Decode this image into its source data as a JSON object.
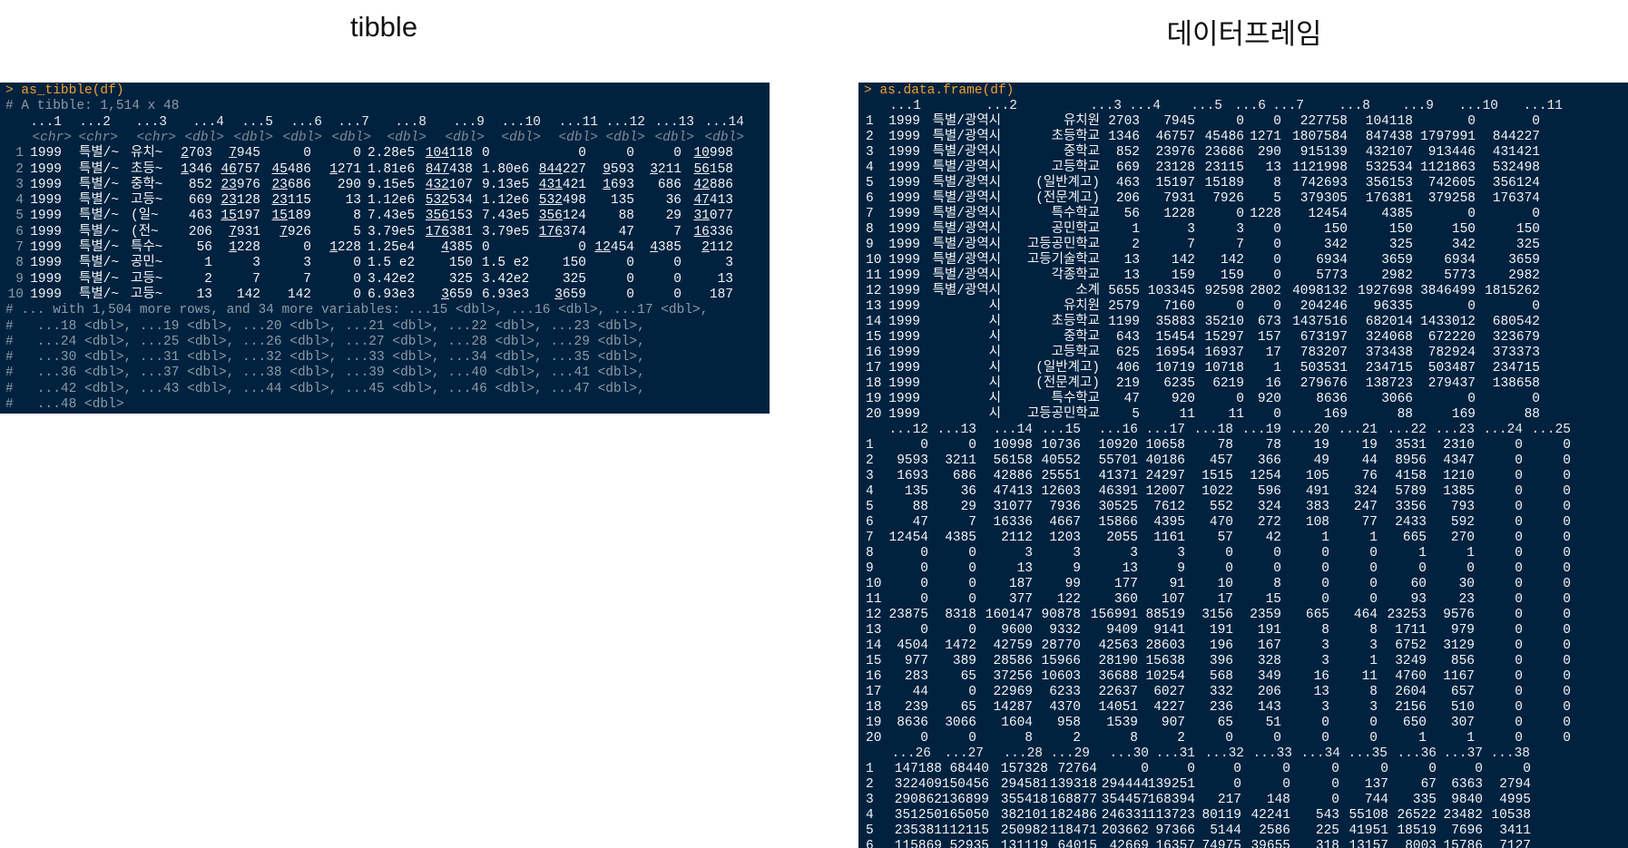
{
  "tibble": {
    "title": "tibble",
    "command": "> as_tibble(df)",
    "summary": "# A tibble: 1,514 x 48",
    "headers": [
      "...1",
      "...2",
      "...3",
      "...4",
      "...5",
      "...6",
      "...7",
      "...8",
      "...9",
      "...10",
      "...11",
      "...12",
      "...13",
      "...14"
    ],
    "types": [
      "<chr>",
      "<chr>",
      "<chr>",
      "<dbl>",
      "<dbl>",
      "<dbl>",
      "<dbl>",
      "<dbl>",
      "<dbl>",
      "<dbl>",
      "<dbl>",
      "<dbl>",
      "<dbl>",
      "<dbl>"
    ],
    "rows": [
      [
        "1",
        "1999",
        "특별/~",
        "유치~",
        "2703",
        "7945",
        "0",
        "0",
        "2.28e5",
        "104118",
        "0",
        "0",
        "0",
        "0",
        "10998"
      ],
      [
        "2",
        "1999",
        "특별/~",
        "초등~",
        "1346",
        "46757",
        "45486",
        "1271",
        "1.81e6",
        "847438",
        "1.80e6",
        "844227",
        "9593",
        "3211",
        "56158"
      ],
      [
        "3",
        "1999",
        "특별/~",
        "중학~",
        "852",
        "23976",
        "23686",
        "290",
        "9.15e5",
        "432107",
        "9.13e5",
        "431421",
        "1693",
        "686",
        "42886"
      ],
      [
        "4",
        "1999",
        "특별/~",
        "고등~",
        "669",
        "23128",
        "23115",
        "13",
        "1.12e6",
        "532534",
        "1.12e6",
        "532498",
        "135",
        "36",
        "47413"
      ],
      [
        "5",
        "1999",
        "특별/~",
        "(일~",
        "463",
        "15197",
        "15189",
        "8",
        "7.43e5",
        "356153",
        "7.43e5",
        "356124",
        "88",
        "29",
        "31077"
      ],
      [
        "6",
        "1999",
        "특별/~",
        "(전~",
        "206",
        "7931",
        "7926",
        "5",
        "3.79e5",
        "176381",
        "3.79e5",
        "176374",
        "47",
        "7",
        "16336"
      ],
      [
        "7",
        "1999",
        "특별/~",
        "특수~",
        "56",
        "1228",
        "0",
        "1228",
        "1.25e4",
        "4385",
        "0",
        "0",
        "12454",
        "4385",
        "2112"
      ],
      [
        "8",
        "1999",
        "특별/~",
        "공민~",
        "1",
        "3",
        "3",
        "0",
        "1.5 e2",
        "150",
        "1.5 e2",
        "150",
        "0",
        "0",
        "3"
      ],
      [
        "9",
        "1999",
        "특별/~",
        "고등~",
        "2",
        "7",
        "7",
        "0",
        "3.42e2",
        "325",
        "3.42e2",
        "325",
        "0",
        "0",
        "13"
      ],
      [
        "10",
        "1999",
        "특별/~",
        "고등~",
        "13",
        "142",
        "142",
        "0",
        "6.93e3",
        "3659",
        "6.93e3",
        "3659",
        "0",
        "0",
        "187"
      ]
    ],
    "footer": [
      "# ... with 1,504 more rows, and 34 more variables: ...15 <dbl>, ...16 <dbl>, ...17 <dbl>,",
      "#   ...18 <dbl>, ...19 <dbl>, ...20 <dbl>, ...21 <dbl>, ...22 <dbl>, ...23 <dbl>,",
      "#   ...24 <dbl>, ...25 <dbl>, ...26 <dbl>, ...27 <dbl>, ...28 <dbl>, ...29 <dbl>,",
      "#   ...30 <dbl>, ...31 <dbl>, ...32 <dbl>, ...33 <dbl>, ...34 <dbl>, ...35 <dbl>,",
      "#   ...36 <dbl>, ...37 <dbl>, ...38 <dbl>, ...39 <dbl>, ...40 <dbl>, ...41 <dbl>,",
      "#   ...42 <dbl>, ...43 <dbl>, ...44 <dbl>, ...45 <dbl>, ...46 <dbl>, ...47 <dbl>,",
      "#   ...48 <dbl>"
    ]
  },
  "data_frame": {
    "title": "데이터프레임",
    "command": "> as.data.frame(df)",
    "blocks": [
      {
        "headers": [
          "...1",
          "...2",
          "...3",
          "...4",
          "...5",
          "...6",
          "...7",
          "...8",
          "...9",
          "...10",
          "...11"
        ],
        "rows": [
          [
            "1",
            "1999",
            "특별/광역시",
            "유치원",
            "2703",
            "7945",
            "0",
            "0",
            "227758",
            "104118",
            "0",
            "0"
          ],
          [
            "2",
            "1999",
            "특별/광역시",
            "초등학교",
            "1346",
            "46757",
            "45486",
            "1271",
            "1807584",
            "847438",
            "1797991",
            "844227"
          ],
          [
            "3",
            "1999",
            "특별/광역시",
            "중학교",
            "852",
            "23976",
            "23686",
            "290",
            "915139",
            "432107",
            "913446",
            "431421"
          ],
          [
            "4",
            "1999",
            "특별/광역시",
            "고등학교",
            "669",
            "23128",
            "23115",
            "13",
            "1121998",
            "532534",
            "1121863",
            "532498"
          ],
          [
            "5",
            "1999",
            "특별/광역시",
            "(일반계고)",
            "463",
            "15197",
            "15189",
            "8",
            "742693",
            "356153",
            "742605",
            "356124"
          ],
          [
            "6",
            "1999",
            "특별/광역시",
            "(전문계고)",
            "206",
            "7931",
            "7926",
            "5",
            "379305",
            "176381",
            "379258",
            "176374"
          ],
          [
            "7",
            "1999",
            "특별/광역시",
            "특수학교",
            "56",
            "1228",
            "0",
            "1228",
            "12454",
            "4385",
            "0",
            "0"
          ],
          [
            "8",
            "1999",
            "특별/광역시",
            "공민학교",
            "1",
            "3",
            "3",
            "0",
            "150",
            "150",
            "150",
            "150"
          ],
          [
            "9",
            "1999",
            "특별/광역시",
            "고등공민학교",
            "2",
            "7",
            "7",
            "0",
            "342",
            "325",
            "342",
            "325"
          ],
          [
            "10",
            "1999",
            "특별/광역시",
            "고등기술학교",
            "13",
            "142",
            "142",
            "0",
            "6934",
            "3659",
            "6934",
            "3659"
          ],
          [
            "11",
            "1999",
            "특별/광역시",
            "각종학교",
            "13",
            "159",
            "159",
            "0",
            "5773",
            "2982",
            "5773",
            "2982"
          ],
          [
            "12",
            "1999",
            "특별/광역시",
            "소계",
            "5655",
            "103345",
            "92598",
            "2802",
            "4098132",
            "1927698",
            "3846499",
            "1815262"
          ],
          [
            "13",
            "1999",
            "시",
            "유치원",
            "2579",
            "7160",
            "0",
            "0",
            "204246",
            "96335",
            "0",
            "0"
          ],
          [
            "14",
            "1999",
            "시",
            "초등학교",
            "1199",
            "35883",
            "35210",
            "673",
            "1437516",
            "682014",
            "1433012",
            "680542"
          ],
          [
            "15",
            "1999",
            "시",
            "중학교",
            "643",
            "15454",
            "15297",
            "157",
            "673197",
            "324068",
            "672220",
            "323679"
          ],
          [
            "16",
            "1999",
            "시",
            "고등학교",
            "625",
            "16954",
            "16937",
            "17",
            "783207",
            "373438",
            "782924",
            "373373"
          ],
          [
            "17",
            "1999",
            "시",
            "(일반계고)",
            "406",
            "10719",
            "10718",
            "1",
            "503531",
            "234715",
            "503487",
            "234715"
          ],
          [
            "18",
            "1999",
            "시",
            "(전문계고)",
            "219",
            "6235",
            "6219",
            "16",
            "279676",
            "138723",
            "279437",
            "138658"
          ],
          [
            "19",
            "1999",
            "시",
            "특수학교",
            "47",
            "920",
            "0",
            "920",
            "8636",
            "3066",
            "0",
            "0"
          ],
          [
            "20",
            "1999",
            "시",
            "고등공민학교",
            "5",
            "11",
            "11",
            "0",
            "169",
            "88",
            "169",
            "88"
          ]
        ]
      },
      {
        "headers": [
          "...12",
          "...13",
          "...14",
          "...15",
          "...16",
          "...17",
          "...18",
          "...19",
          "...20",
          "...21",
          "...22",
          "...23",
          "...24",
          "...25"
        ],
        "rows": [
          [
            "1",
            "0",
            "0",
            "10998",
            "10736",
            "10920",
            "10658",
            "78",
            "78",
            "19",
            "19",
            "3531",
            "2310",
            "0",
            "0"
          ],
          [
            "2",
            "9593",
            "3211",
            "56158",
            "40552",
            "55701",
            "40186",
            "457",
            "366",
            "49",
            "44",
            "8956",
            "4347",
            "0",
            "0"
          ],
          [
            "3",
            "1693",
            "686",
            "42886",
            "25551",
            "41371",
            "24297",
            "1515",
            "1254",
            "105",
            "76",
            "4158",
            "1210",
            "0",
            "0"
          ],
          [
            "4",
            "135",
            "36",
            "47413",
            "12603",
            "46391",
            "12007",
            "1022",
            "596",
            "491",
            "324",
            "5789",
            "1385",
            "0",
            "0"
          ],
          [
            "5",
            "88",
            "29",
            "31077",
            "7936",
            "30525",
            "7612",
            "552",
            "324",
            "383",
            "247",
            "3356",
            "793",
            "0",
            "0"
          ],
          [
            "6",
            "47",
            "7",
            "16336",
            "4667",
            "15866",
            "4395",
            "470",
            "272",
            "108",
            "77",
            "2433",
            "592",
            "0",
            "0"
          ],
          [
            "7",
            "12454",
            "4385",
            "2112",
            "1203",
            "2055",
            "1161",
            "57",
            "42",
            "1",
            "1",
            "665",
            "270",
            "0",
            "0"
          ],
          [
            "8",
            "0",
            "0",
            "3",
            "3",
            "3",
            "3",
            "0",
            "0",
            "0",
            "0",
            "1",
            "1",
            "0",
            "0"
          ],
          [
            "9",
            "0",
            "0",
            "13",
            "9",
            "13",
            "9",
            "0",
            "0",
            "0",
            "0",
            "0",
            "0",
            "0",
            "0"
          ],
          [
            "10",
            "0",
            "0",
            "187",
            "99",
            "177",
            "91",
            "10",
            "8",
            "0",
            "0",
            "60",
            "30",
            "0",
            "0"
          ],
          [
            "11",
            "0",
            "0",
            "377",
            "122",
            "360",
            "107",
            "17",
            "15",
            "0",
            "0",
            "93",
            "23",
            "0",
            "0"
          ],
          [
            "12",
            "23875",
            "8318",
            "160147",
            "90878",
            "156991",
            "88519",
            "3156",
            "2359",
            "665",
            "464",
            "23253",
            "9576",
            "0",
            "0"
          ],
          [
            "13",
            "0",
            "0",
            "9600",
            "9332",
            "9409",
            "9141",
            "191",
            "191",
            "8",
            "8",
            "1711",
            "979",
            "0",
            "0"
          ],
          [
            "14",
            "4504",
            "1472",
            "42759",
            "28770",
            "42563",
            "28603",
            "196",
            "167",
            "3",
            "3",
            "6752",
            "3129",
            "0",
            "0"
          ],
          [
            "15",
            "977",
            "389",
            "28586",
            "15966",
            "28190",
            "15638",
            "396",
            "328",
            "3",
            "1",
            "3249",
            "856",
            "0",
            "0"
          ],
          [
            "16",
            "283",
            "65",
            "37256",
            "10603",
            "36688",
            "10254",
            "568",
            "349",
            "16",
            "11",
            "4760",
            "1167",
            "0",
            "0"
          ],
          [
            "17",
            "44",
            "0",
            "22969",
            "6233",
            "22637",
            "6027",
            "332",
            "206",
            "13",
            "8",
            "2604",
            "657",
            "0",
            "0"
          ],
          [
            "18",
            "239",
            "65",
            "14287",
            "4370",
            "14051",
            "4227",
            "236",
            "143",
            "3",
            "3",
            "2156",
            "510",
            "0",
            "0"
          ],
          [
            "19",
            "8636",
            "3066",
            "1604",
            "958",
            "1539",
            "907",
            "65",
            "51",
            "0",
            "0",
            "650",
            "307",
            "0",
            "0"
          ],
          [
            "20",
            "0",
            "0",
            "8",
            "2",
            "8",
            "2",
            "0",
            "0",
            "0",
            "0",
            "1",
            "1",
            "0",
            "0"
          ]
        ]
      },
      {
        "headers": [
          "...26",
          "...27",
          "...28",
          "...29",
          "...30",
          "...31",
          "...32",
          "...33",
          "...34",
          "...35",
          "...36",
          "...37",
          "...38"
        ],
        "rows": [
          [
            "1",
            "147188",
            "68440",
            "157328",
            "72764",
            "0",
            "0",
            "0",
            "0",
            "0",
            "0",
            "0",
            "0",
            "0"
          ],
          [
            "2",
            "322409",
            "150456",
            "294581",
            "139318",
            "294444",
            "139251",
            "0",
            "0",
            "0",
            "137",
            "67",
            "6363",
            "2794"
          ],
          [
            "3",
            "290862",
            "136899",
            "355418",
            "168877",
            "354457",
            "168394",
            "217",
            "148",
            "0",
            "744",
            "335",
            "9840",
            "4995"
          ],
          [
            "4",
            "351250",
            "165050",
            "382101",
            "182486",
            "246331",
            "113723",
            "80119",
            "42241",
            "543",
            "55108",
            "26522",
            "23482",
            "10538"
          ],
          [
            "5",
            "235381",
            "112115",
            "250982",
            "118471",
            "203662",
            "97366",
            "5144",
            "2586",
            "225",
            "41951",
            "18519",
            "7696",
            "3411"
          ],
          [
            "6",
            "115869",
            "52935",
            "131119",
            "64015",
            "42669",
            "16357",
            "74975",
            "39655",
            "318",
            "13157",
            "8003",
            "15786",
            "7127"
          ]
        ]
      }
    ]
  }
}
